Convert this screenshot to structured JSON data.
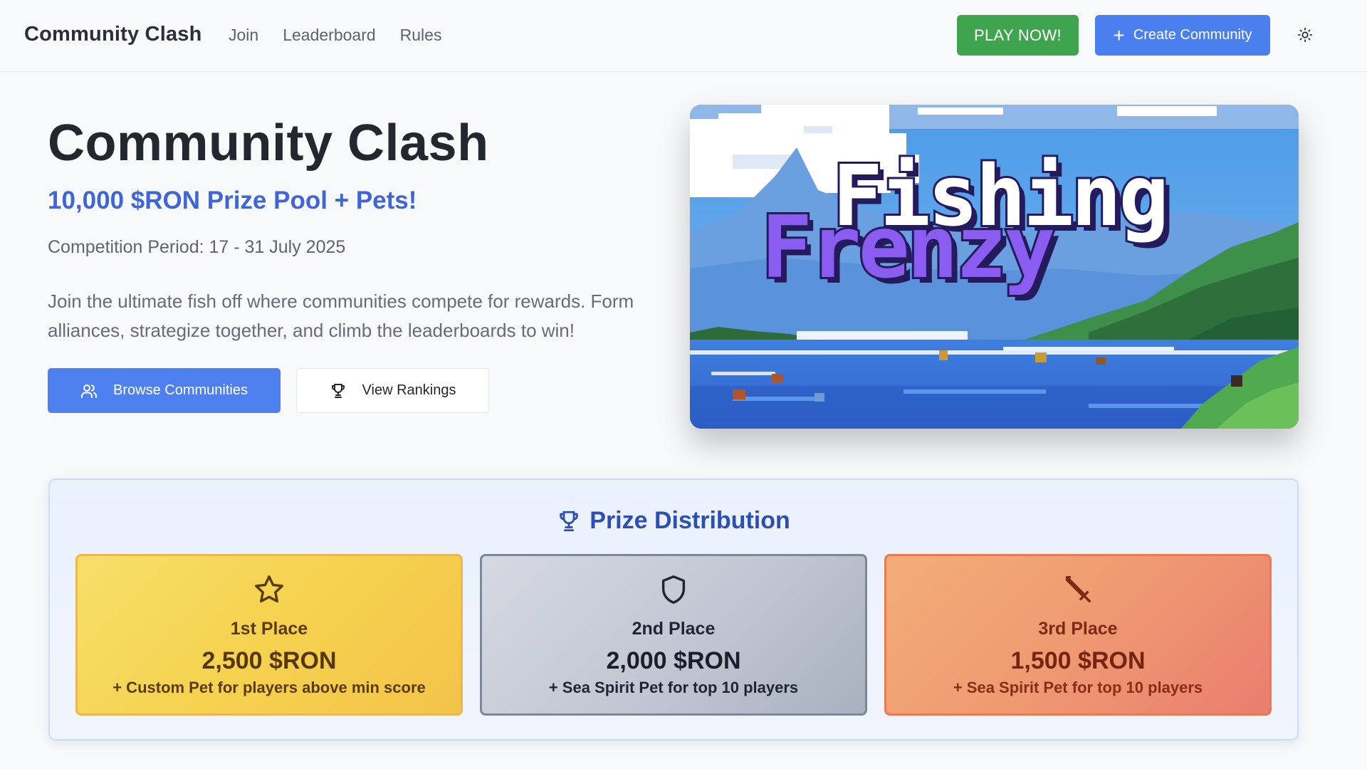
{
  "nav": {
    "brand": "Community Clash",
    "links": [
      "Join",
      "Leaderboard",
      "Rules"
    ],
    "play_label": "PLAY NOW!",
    "create_label": "Create Community",
    "theme_icon": "sun-icon"
  },
  "hero": {
    "title": "Community Clash",
    "subtitle": "10,000 $RON Prize Pool + Pets!",
    "period": "Competition Period: 17 - 31 July 2025",
    "description": "Join the ultimate fish off where communities compete for rewards. Form alliances, strategize together, and climb the leaderboards to win!",
    "browse_label": "Browse Communities",
    "browse_icon": "users-icon",
    "rankings_label": "View Rankings",
    "rankings_icon": "trophy-icon"
  },
  "banner": {
    "logo_line1": "Fishing",
    "logo_line2": "Frenzy"
  },
  "prizes": {
    "heading": "Prize Distribution",
    "heading_icon": "trophy-icon",
    "cards": [
      {
        "place": "1st Place",
        "amount": "2,500 $RON",
        "bonus": "+ Custom Pet for players above min score",
        "icon": "star-icon",
        "color": "#f6d24f"
      },
      {
        "place": "2nd Place",
        "amount": "2,000 $RON",
        "bonus": "+ Sea Spirit Pet for top 10 players",
        "icon": "shield-icon",
        "color": "#c1c7d2"
      },
      {
        "place": "3rd Place",
        "amount": "1,500 $RON",
        "bonus": "+ Sea Spirit Pet for top 10 players",
        "icon": "sword-icon",
        "color": "#ef9a72"
      }
    ]
  },
  "colors": {
    "primary": "#4f80ef",
    "play": "#3ea44e",
    "accent_text": "#3f66d8"
  }
}
